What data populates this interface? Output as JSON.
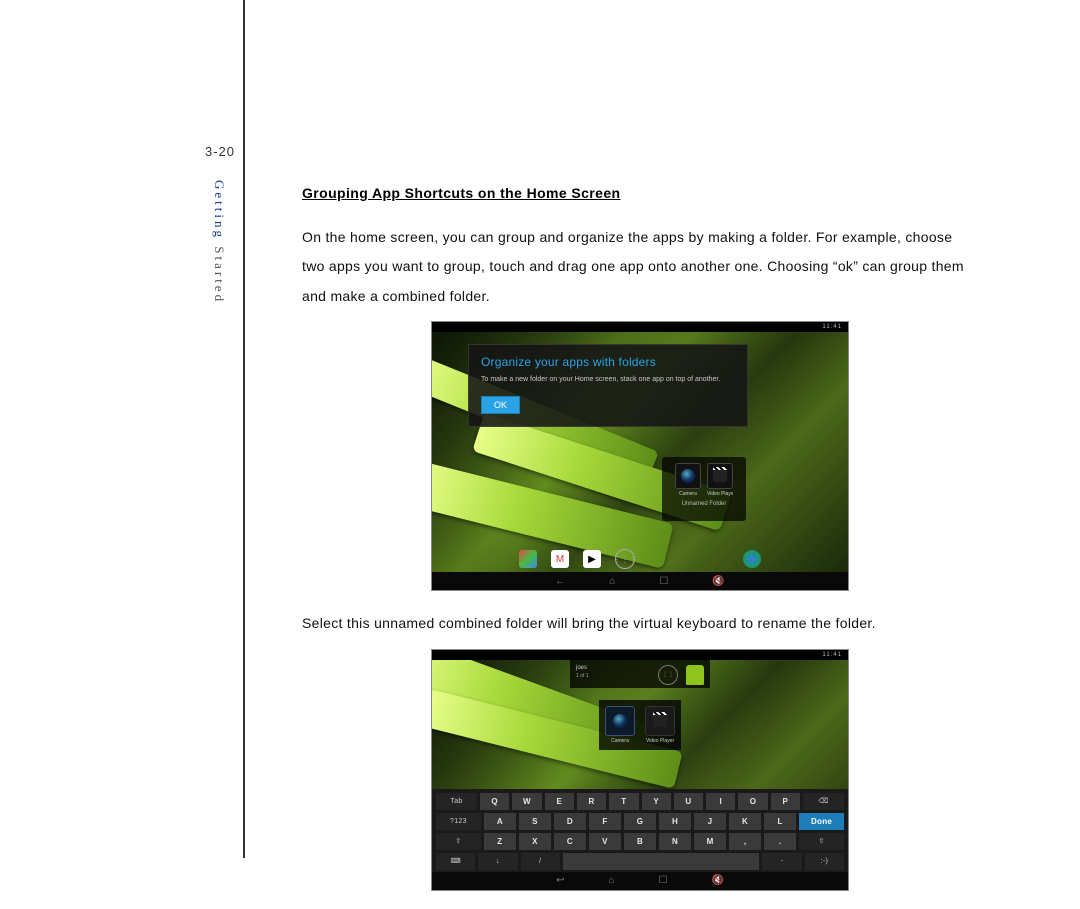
{
  "page_number": "3-20",
  "sidebar": {
    "word1": "Getting",
    "word2": "Started"
  },
  "section_title": "Grouping App Shortcuts on the Home Screen",
  "para1": "On the home screen, you can group and organize the apps by making a folder. For example, choose two apps you want to group, touch and drag one app onto another one. Choosing “ok” can group them and make a combined folder.",
  "para2": "Select this unnamed combined folder will bring the virtual keyboard to rename the folder.",
  "shot1": {
    "clock": "11:41",
    "dialog_title": "Organize your apps with folders",
    "dialog_body": "To make a new folder on your Home screen, stack one app on top of another.",
    "ok": "OK",
    "app1": "Camera",
    "app2": "Video Player",
    "folder_name": "Unnamed Folder"
  },
  "shot2": {
    "clock": "11:41",
    "folder_header": "joes",
    "count": "1 of 1",
    "app1": "Camera",
    "app2": "Video Player",
    "keys_r1_left": "Tab",
    "keys_r1": [
      "Q",
      "W",
      "E",
      "R",
      "T",
      "Y",
      "U",
      "I",
      "O",
      "P"
    ],
    "keys_r1_right": "⌫",
    "keys_r2_left": "?123",
    "keys_r2": [
      "A",
      "S",
      "D",
      "F",
      "G",
      "H",
      "J",
      "K",
      "L"
    ],
    "keys_r2_right": "Done",
    "keys_r3_left": "⇧",
    "keys_r3": [
      "Z",
      "X",
      "C",
      "V",
      "B",
      "N",
      "M",
      ",",
      "."
    ],
    "keys_r3_right": "⇧",
    "keys_r4": {
      "hide": "⌨",
      "mic": "↓",
      "slash": "/",
      "dash": "-",
      "smile": ":-)"
    }
  }
}
